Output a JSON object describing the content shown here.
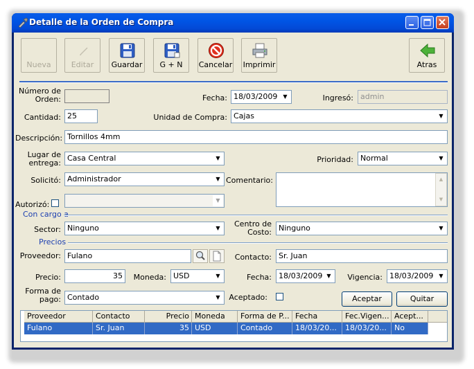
{
  "window": {
    "title": "Detalle de la Orden de Compra"
  },
  "toolbar": {
    "nueva": "Nueva",
    "editar": "Editar",
    "guardar": "Guardar",
    "gn": "G + N",
    "cancelar": "Cancelar",
    "imprimir": "Imprimir",
    "atras": "Atras"
  },
  "form": {
    "numero_label": "Número de Orden:",
    "numero_value": "",
    "fecha_label": "Fecha:",
    "fecha_value": "18/03/2009",
    "ingreso_label": "Ingresó:",
    "ingreso_value": "admin",
    "cantidad_label": "Cantidad:",
    "cantidad_value": "25",
    "unidad_label": "Unidad de Compra:",
    "unidad_value": "Cajas",
    "descripcion_label": "Descripción:",
    "descripcion_value": "Tornillos 4mm",
    "lugar_label": "Lugar de entrega:",
    "lugar_value": "Casa Central",
    "prioridad_label": "Prioridad:",
    "prioridad_value": "Normal",
    "solicito_label": "Solicitó:",
    "solicito_value": "Administrador",
    "comentario_label": "Comentario:",
    "comentario_value": "",
    "autorizo_label": "Autorizó:",
    "autorizo_value": "",
    "cargo_section": "Con cargo a",
    "sector_label": "Sector:",
    "sector_value": "Ninguno",
    "centro_label": "Centro de Costo:",
    "centro_value": "Ninguno",
    "precios_section": "Precios",
    "proveedor_label": "Proveedor:",
    "proveedor_value": "Fulano",
    "contacto_label": "Contacto:",
    "contacto_value": "Sr. Juan",
    "precio_label": "Precio:",
    "precio_value": "35",
    "moneda_label": "Moneda:",
    "moneda_value": "USD",
    "fecha2_label": "Fecha:",
    "fecha2_value": "18/03/2009",
    "vigencia_label": "Vigencia:",
    "vigencia_value": "18/03/2009",
    "forma_label": "Forma de pago:",
    "forma_value": "Contado",
    "aceptado_label": "Aceptado:",
    "aceptar_btn": "Aceptar",
    "quitar_btn": "Quitar"
  },
  "grid": {
    "headers": [
      "Proveedor",
      "Contacto",
      "Precio",
      "Moneda",
      "Forma de P...",
      "Fecha",
      "Fec.Vigen...",
      "Acept..."
    ],
    "rows": [
      [
        "Fulano",
        "Sr. Juan",
        "35",
        "USD",
        "Contado",
        "18/03/20...",
        "18/03/20...",
        "No"
      ]
    ]
  }
}
